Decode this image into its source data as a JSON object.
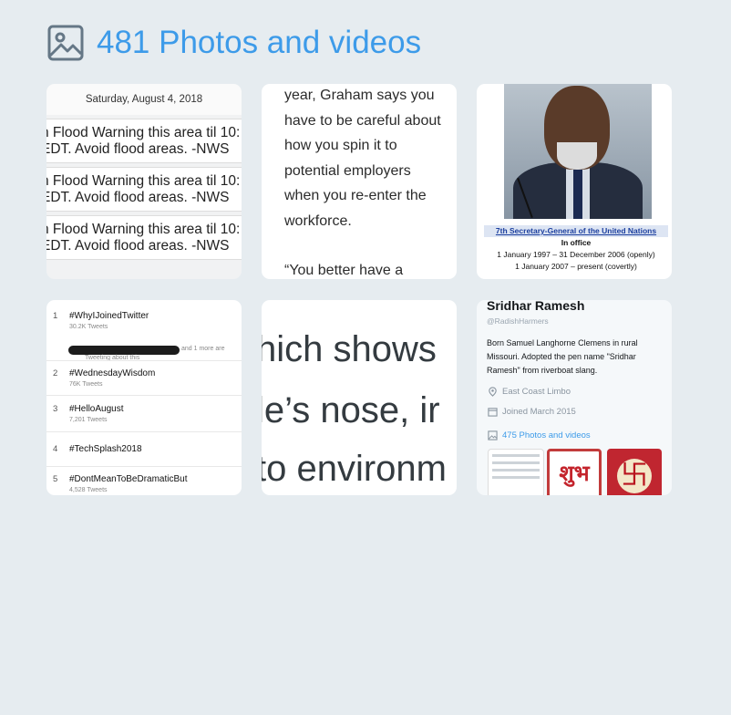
{
  "header": {
    "title": "481 Photos and videos",
    "icon": "image-icon"
  },
  "tiles": {
    "flood": {
      "date": "Saturday, August 4, 2018",
      "messages": [
        {
          "line1": "n Flood Warning this area til 10:",
          "line2": "EDT. Avoid flood areas. -NWS"
        },
        {
          "line1": "n Flood Warning this area til 10:",
          "line2": "EDT. Avoid flood areas. -NWS"
        },
        {
          "line1": "n Flood Warning this area til 10:",
          "line2": "EDT. Avoid flood areas. -NWS"
        }
      ]
    },
    "article": {
      "para1": "year, Graham says you have to be careful about how you spin it to potential employers when you re-enter the workforce.",
      "para2": "“You better have a"
    },
    "wiki": {
      "role": "7th Secretary-General of the United Nations",
      "office": "In office",
      "term1": "1 January 1997 – 31 December 2006 (openly)",
      "term2": "1 January 2007 – present (covertly)"
    },
    "trends": {
      "items": [
        {
          "rank": "1",
          "name": "#WhyIJoinedTwitter",
          "count": "30.2K Tweets"
        },
        {
          "rank": "2",
          "name": "#WednesdayWisdom",
          "count": "76K Tweets"
        },
        {
          "rank": "3",
          "name": "#HelloAugust",
          "count": "7,201 Tweets"
        },
        {
          "rank": "4",
          "name": "#TechSplash2018",
          "count": ""
        },
        {
          "rank": "5",
          "name": "#DontMeanToBeDramaticBut",
          "count": "4,528 Tweets"
        }
      ],
      "more": "and 1 more are",
      "sub": "Tweeting about this"
    },
    "zoom": {
      "lines": [
        "hich shows",
        "le’s nose, ir",
        "to environm"
      ]
    },
    "profile": {
      "name": "Sridhar Ramesh",
      "handle": "@RadishHarmers",
      "bio": "Born Samuel Langhorne Clemens in rural Missouri. Adopted the pen name \"Sridhar Ramesh\" from riverboat slang.",
      "location": "East Coast Limbo",
      "joined": "Joined March 2015",
      "photos": "475 Photos and videos",
      "thumb_text": "शुभ",
      "thumb_symbol": "卐"
    }
  },
  "colors": {
    "accent": "#3d9be9",
    "background": "#e6ecf0"
  }
}
